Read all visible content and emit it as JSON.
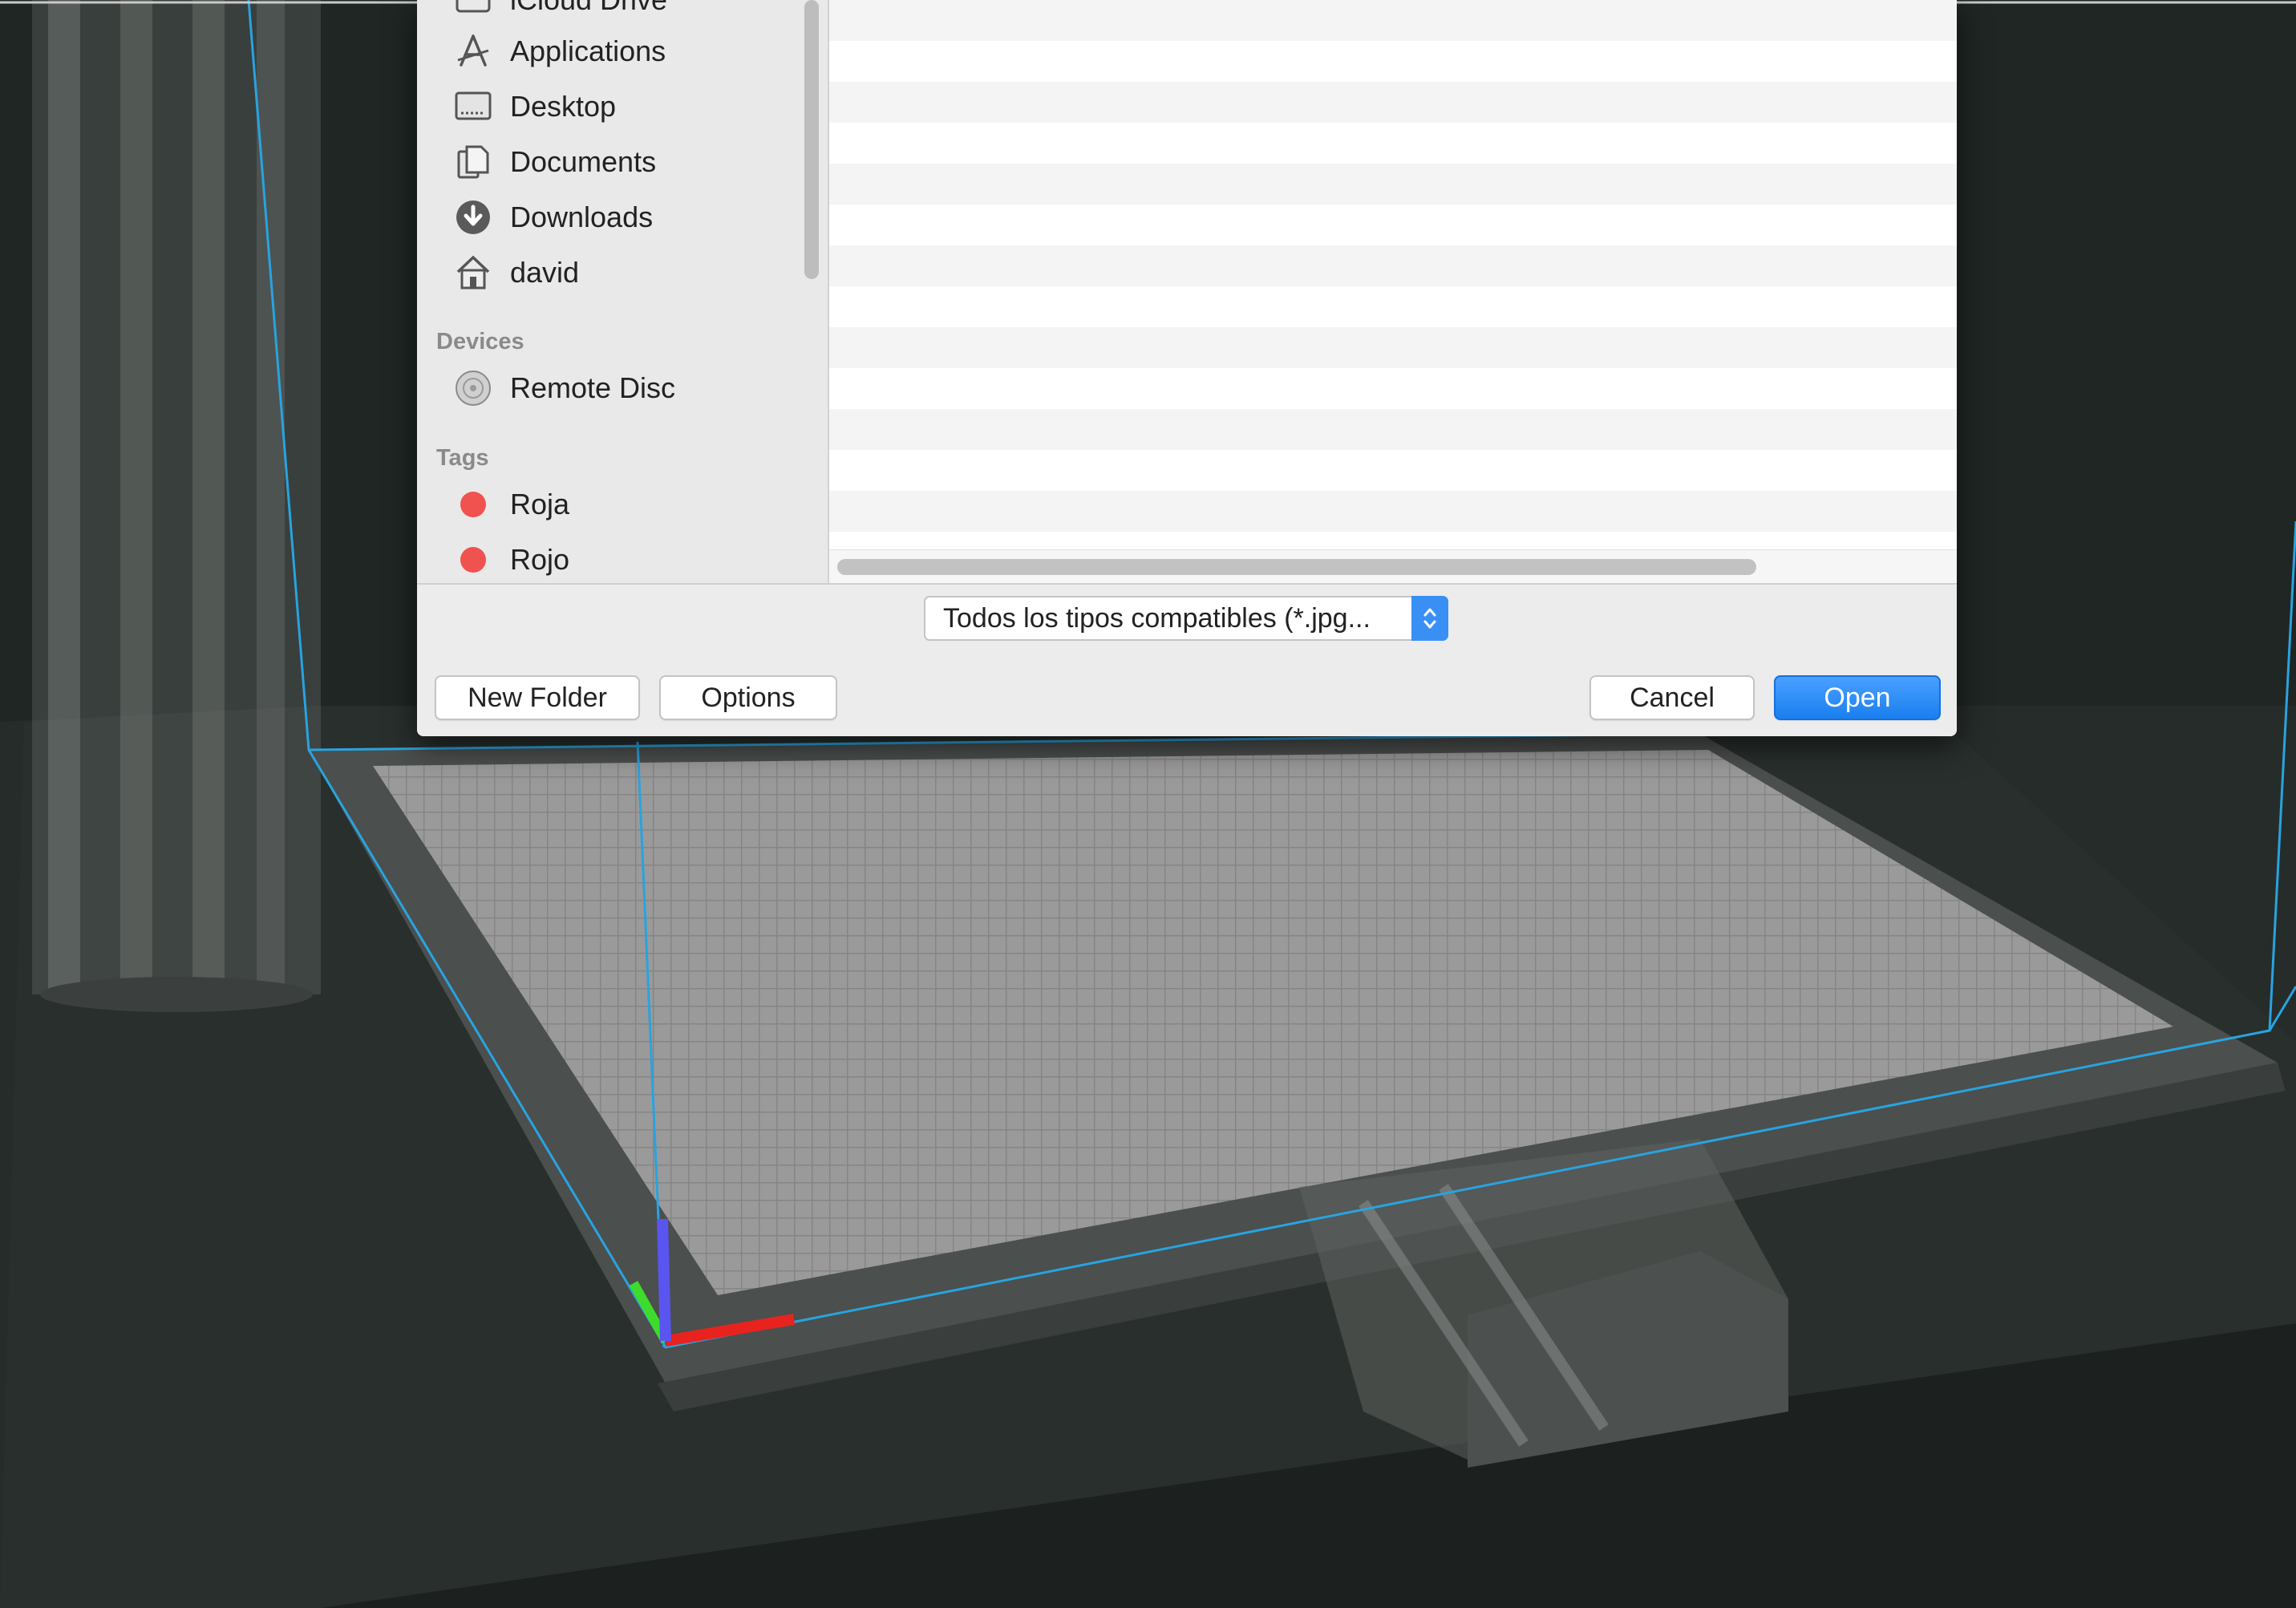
{
  "sidebar": {
    "partial_item": "iCloud Drive",
    "favorites": [
      {
        "label": "Applications",
        "icon": "applications-icon"
      },
      {
        "label": "Desktop",
        "icon": "desktop-icon"
      },
      {
        "label": "Documents",
        "icon": "documents-icon"
      },
      {
        "label": "Downloads",
        "icon": "downloads-icon"
      },
      {
        "label": "david",
        "icon": "home-icon"
      }
    ],
    "devices_header": "Devices",
    "devices": [
      {
        "label": "Remote Disc",
        "icon": "disc-icon"
      }
    ],
    "tags_header": "Tags",
    "tags": [
      {
        "label": "Roja",
        "color": "#f0524f"
      },
      {
        "label": "Rojo",
        "color": "#f0524f"
      }
    ]
  },
  "filter": {
    "selected": "Todos los tipos compatibles (*.jpg..."
  },
  "buttons": {
    "new_folder": "New Folder",
    "options": "Options",
    "cancel": "Cancel",
    "open": "Open"
  },
  "colors": {
    "accent": "#1a7ff0",
    "tag_red": "#f0524f",
    "build_volume": "#29a3e0",
    "axis_x": "#e8231f",
    "axis_y": "#3ddc2c",
    "axis_z": "#5a55f0"
  }
}
